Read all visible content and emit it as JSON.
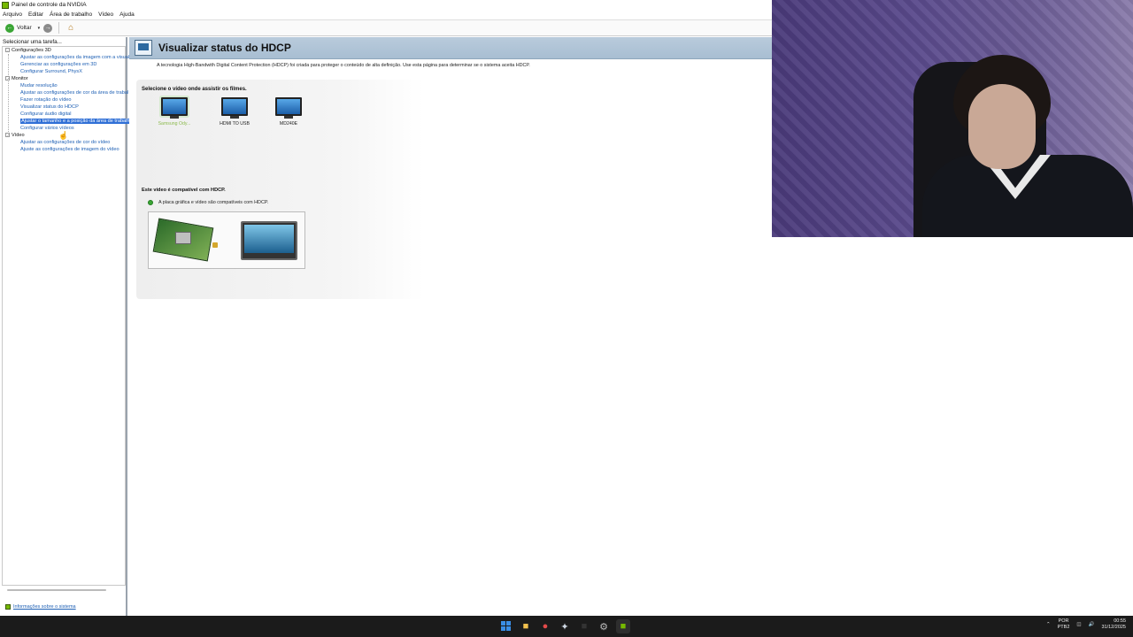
{
  "window": {
    "title": "Painel de controle da NVIDIA"
  },
  "menu": [
    "Arquivo",
    "Editar",
    "Área de trabalho",
    "Vídeo",
    "Ajuda"
  ],
  "toolbar": {
    "back_label": "Voltar"
  },
  "sidebar": {
    "header": "Selecionar uma tarefa...",
    "categories": [
      {
        "label": "Configurações 3D",
        "items": [
          "Ajustar as configurações da imagem com a visuali",
          "Gerenciar as configurações em 3D",
          "Configurar Surround, PhysX"
        ]
      },
      {
        "label": "Monitor",
        "items": [
          "Mudar resolução",
          "Ajustar as configurações de cor da área de trabal",
          "Fazer rotação do vídeo",
          "Visualizar status do HDCP",
          "Configurar áudio digital",
          "Ajustar o tamanho e a posição da área de trabalh",
          "Configurar vários vídeos"
        ]
      },
      {
        "label": "Vídeo",
        "items": [
          "Ajustar as configurações de cor do vídeo",
          "Ajuste as configurações de imagem do vídeo"
        ]
      }
    ],
    "system_info": "Informações sobre o sistema"
  },
  "page": {
    "title": "Visualizar status do HDCP",
    "description": "A tecnologia High-Bandwith Digital Content Protection (HDCP) foi criada para proteger o conteúdo de alta definição. Use esta página para determinar se o sistema aceita HDCP.",
    "select_label": "Selecione o vídeo onde assistir os filmes.",
    "monitors": [
      {
        "label": "Samsung Ody...",
        "active": true
      },
      {
        "label": "HDMI TO USB",
        "active": false
      },
      {
        "label": "MD240E",
        "active": false
      }
    ],
    "compat_label": "Este vídeo é compatível com HDCP.",
    "compat_status": "A placa gráfica e vídeo são compatíveis com HDCP."
  },
  "taskbar": {
    "lang_top": "POR",
    "lang_bottom": "PTB2",
    "time": "00:55",
    "date": "31/12/2025"
  },
  "colors": {
    "accent": "#76b900",
    "link": "#1d5fb4",
    "selection": "#2f6fd6",
    "ok": "#3aa535"
  }
}
